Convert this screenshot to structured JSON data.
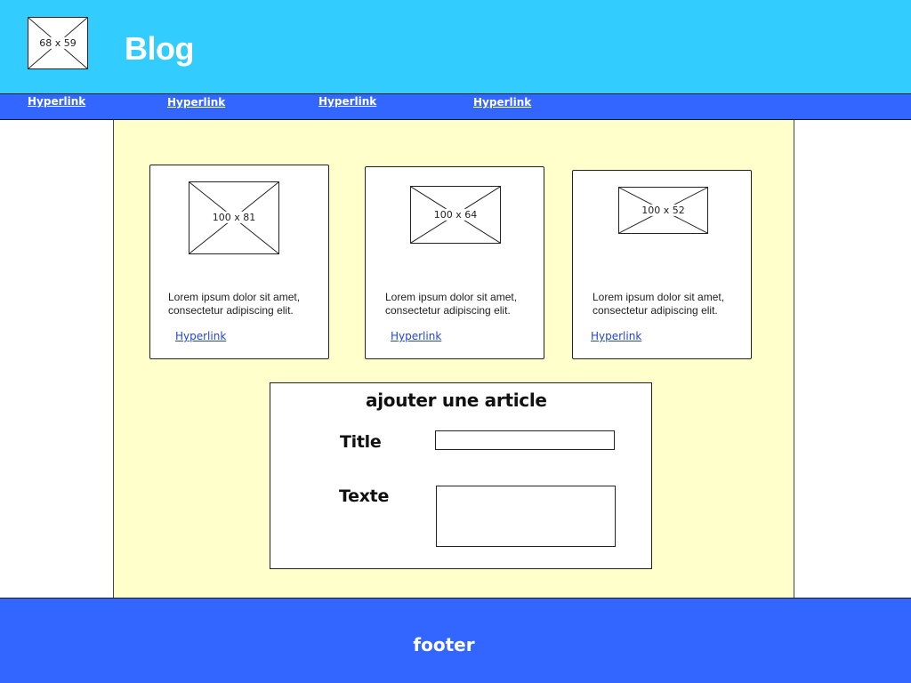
{
  "header": {
    "logo_label": "68 x 59",
    "site_title": "Blog"
  },
  "nav": {
    "links": [
      "Hyperlink",
      "Hyperlink",
      "Hyperlink",
      "Hyperlink"
    ]
  },
  "cards": [
    {
      "image_label": "100 x 81",
      "text": "Lorem ipsum dolor sit amet, consectetur adipiscing elit.",
      "link": "Hyperlink"
    },
    {
      "image_label": "100 x 64",
      "text": "Lorem ipsum dolor sit amet, consectetur adipiscing elit.",
      "link": "Hyperlink"
    },
    {
      "image_label": "100 x 52",
      "text": "Lorem ipsum dolor sit amet, consectetur adipiscing elit.",
      "link": "Hyperlink"
    }
  ],
  "form": {
    "title": "ajouter une article",
    "title_label": "Title",
    "title_value": "",
    "text_label": "Texte",
    "text_value": ""
  },
  "footer": {
    "text": "footer"
  },
  "colors": {
    "header_bg": "#33ccff",
    "nav_bg": "#3366ff",
    "content_bg": "#ffffcc",
    "footer_bg": "#3366ff",
    "link_color": "#2244dd"
  }
}
